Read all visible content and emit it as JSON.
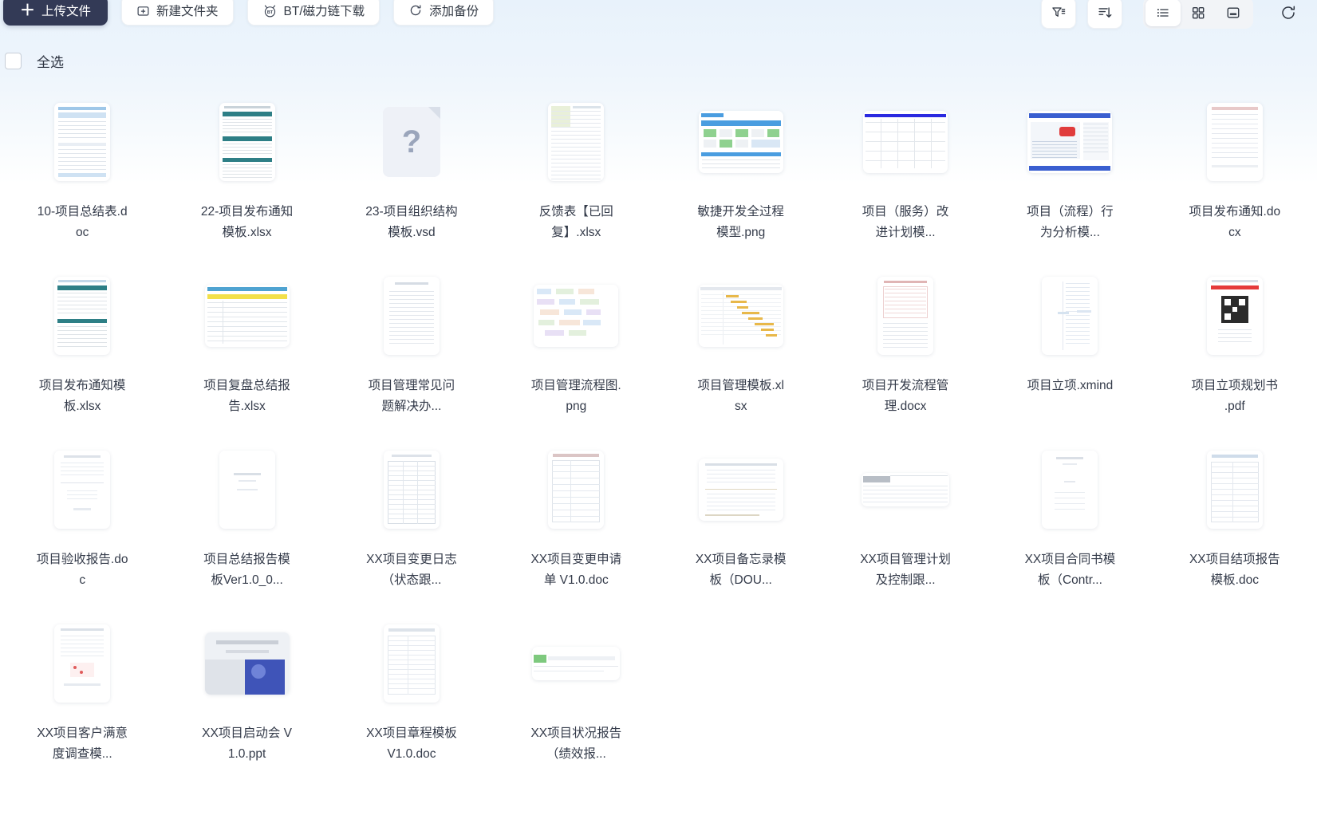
{
  "toolbar": {
    "upload_label": "上传文件",
    "upload_icon": "plus-icon",
    "new_folder_label": "新建文件夹",
    "new_folder_icon": "folder-plus-icon",
    "bt_download_label": "BT/磁力链下载",
    "bt_download_icon": "bt-magnet-icon",
    "add_backup_label": "添加备份",
    "add_backup_icon": "backup-refresh-icon",
    "filter_icon": "filter-icon",
    "sort_icon": "sort-descending-icon",
    "list_view_icon": "list-view-icon",
    "grid_view_icon": "grid-view-icon",
    "detail_view_icon": "detail-view-icon",
    "refresh_icon": "refresh-icon",
    "active_view": "list-view-icon"
  },
  "select_all": {
    "label": "全选",
    "checked": false
  },
  "files": [
    {
      "name": "10-项目总结表.doc",
      "thumb": "form-blue"
    },
    {
      "name": "22-项目发布通知模板.xlsx",
      "thumb": "sheet-teal"
    },
    {
      "name": "23-项目组织结构模板.vsd",
      "thumb": "unknown"
    },
    {
      "name": "反馈表【已回复】.xlsx",
      "thumb": "sheet-dense"
    },
    {
      "name": "敏捷开发全过程模型.png",
      "thumb": "flow-green"
    },
    {
      "name": "项目（服务）改进计划模...",
      "thumb": "table-blue"
    },
    {
      "name": "项目（流程）行为分析模...",
      "thumb": "report-wide"
    },
    {
      "name": "项目发布通知.docx",
      "thumb": "doc-plain"
    },
    {
      "name": "项目发布通知模板.xlsx",
      "thumb": "form-blue2"
    },
    {
      "name": "项目复盘总结报告.xlsx",
      "thumb": "sheet-yellow"
    },
    {
      "name": "项目管理常见问题解决办...",
      "thumb": "doc-text"
    },
    {
      "name": "项目管理流程图.png",
      "thumb": "mindmap"
    },
    {
      "name": "项目管理模板.xlsx",
      "thumb": "gantt"
    },
    {
      "name": "项目开发流程管理.docx",
      "thumb": "doc-chart"
    },
    {
      "name": "项目立项.xmind",
      "thumb": "xmind"
    },
    {
      "name": "项目立项规划书 .pdf",
      "thumb": "qrcode"
    },
    {
      "name": "项目验收报告.doc",
      "thumb": "doc-plain2"
    },
    {
      "name": "项目总结报告模板Ver1.0_0...",
      "thumb": "doc-sparse"
    },
    {
      "name": "XX项目变更日志（状态跟...",
      "thumb": "table-grid"
    },
    {
      "name": "XX项目变更申请单 V1.0.doc",
      "thumb": "form-table"
    },
    {
      "name": "XX项目备忘录模板（DOU...",
      "thumb": "memo-wide"
    },
    {
      "name": "XX项目管理计划及控制跟...",
      "thumb": "wide-sheet"
    },
    {
      "name": "XX项目合同书模板（Contr...",
      "thumb": "contract"
    },
    {
      "name": "XX项目结项报告模板.doc",
      "thumb": "report-form"
    },
    {
      "name": "XX项目客户满意度调查模...",
      "thumb": "survey"
    },
    {
      "name": "XX项目启动会 V1.0.ppt",
      "thumb": "ppt-cover"
    },
    {
      "name": "XX项目章程模板 V1.0.doc",
      "thumb": "charter"
    },
    {
      "name": "XX项目状况报告（绩效报...",
      "thumb": "status-wide"
    }
  ],
  "colors": {
    "primary_button": "#333a56",
    "text": "#343b4a",
    "background_top": "#e8f2fb",
    "segment_bg": "#f2f4f7"
  }
}
